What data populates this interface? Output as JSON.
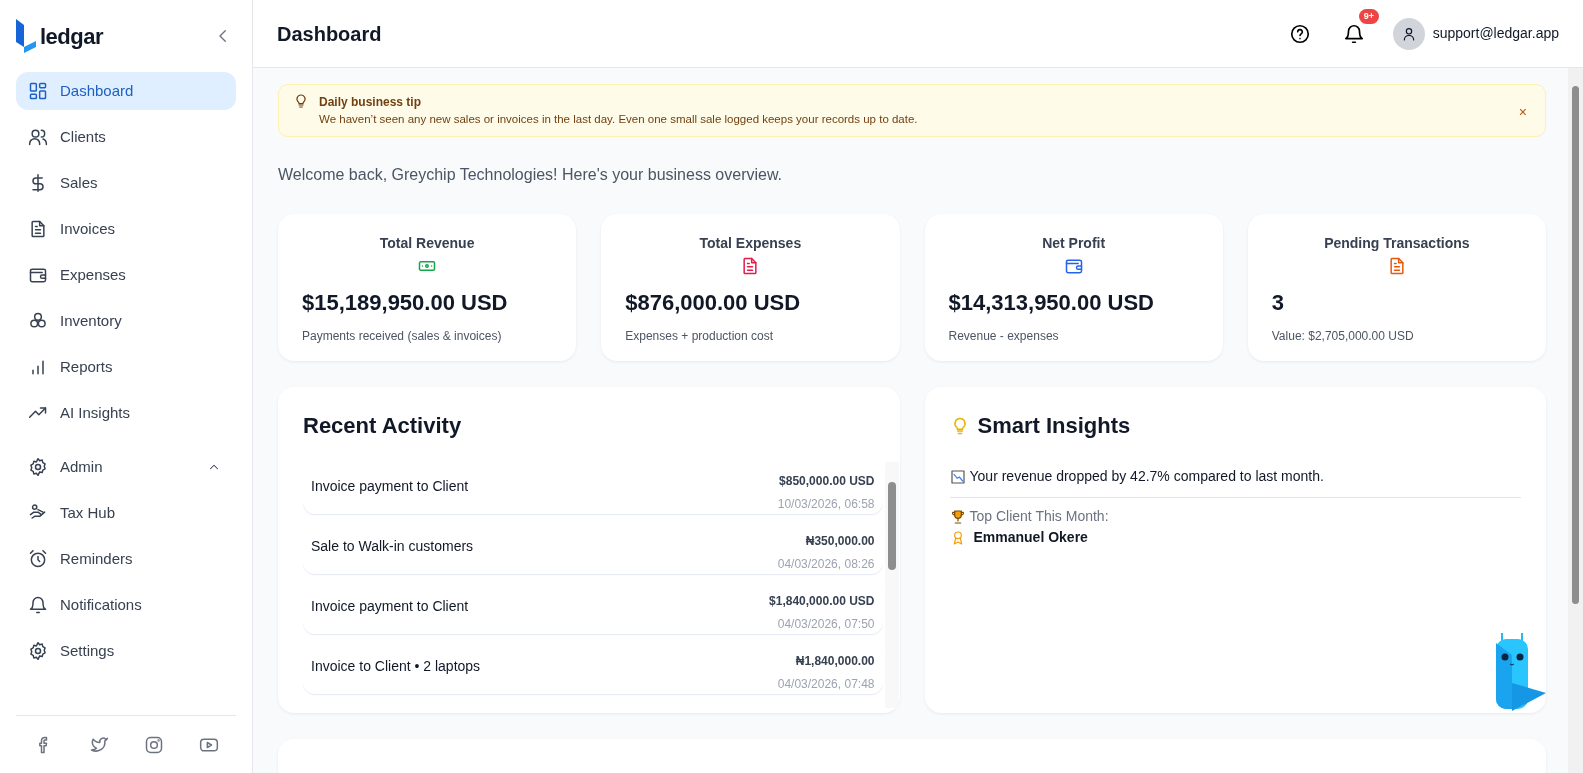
{
  "brand": {
    "name": "ledgar"
  },
  "sidebar": {
    "items": [
      {
        "label": "Dashboard",
        "selected": true
      },
      {
        "label": "Clients",
        "selected": false
      },
      {
        "label": "Sales",
        "selected": false
      },
      {
        "label": "Invoices",
        "selected": false
      },
      {
        "label": "Expenses",
        "selected": false
      },
      {
        "label": "Inventory",
        "selected": false
      },
      {
        "label": "Reports",
        "selected": false
      },
      {
        "label": "AI Insights",
        "selected": false
      }
    ],
    "group": {
      "label": "Admin",
      "expanded": true,
      "children": [
        {
          "label": "Tax Hub",
          "selected": false
        },
        {
          "label": "Reminders",
          "selected": false
        },
        {
          "label": "Notifications",
          "selected": false
        },
        {
          "label": "Settings",
          "selected": false
        }
      ]
    }
  },
  "header": {
    "title": "Dashboard",
    "notification_badge": "9+",
    "user": "support@ledgar.app"
  },
  "tip": {
    "title": "Daily business tip",
    "text": "We haven’t seen any new sales or invoices in the last day. Even one small sale logged keeps your records up to date.",
    "close": "×"
  },
  "welcome": "Welcome back, Greychip Technologies! Here's your business overview.",
  "stats": [
    {
      "title": "Total Revenue",
      "value": "$15,189,950.00 USD",
      "note": "Payments received (sales & invoices)"
    },
    {
      "title": "Total Expenses",
      "value": "$876,000.00 USD",
      "note": "Expenses + production cost"
    },
    {
      "title": "Net Profit",
      "value": "$14,313,950.00 USD",
      "note": "Revenue - expenses"
    },
    {
      "title": "Pending Transactions",
      "value": "3",
      "note": "Value: $2,705,000.00 USD"
    }
  ],
  "recent_activity": {
    "title": "Recent Activity",
    "items": [
      {
        "description": "Invoice payment to Client",
        "amount": "$850,000.00 USD",
        "time": "10/03/2026, 06:58"
      },
      {
        "description": "Sale to Walk-in customers",
        "amount": "₦350,000.00",
        "time": "04/03/2026, 08:26"
      },
      {
        "description": "Invoice payment to Client",
        "amount": "$1,840,000.00 USD",
        "time": "04/03/2026, 07:50"
      },
      {
        "description": "Invoice to Client • 2 laptops",
        "amount": "₦1,840,000.00",
        "time": "04/03/2026, 07:48"
      }
    ]
  },
  "smart_insights": {
    "title": "Smart Insights",
    "message": "Your revenue dropped by 42.7% compared to last month.",
    "top_client_label": "Top Client This Month:",
    "top_client": "Emmanuel Okere"
  }
}
